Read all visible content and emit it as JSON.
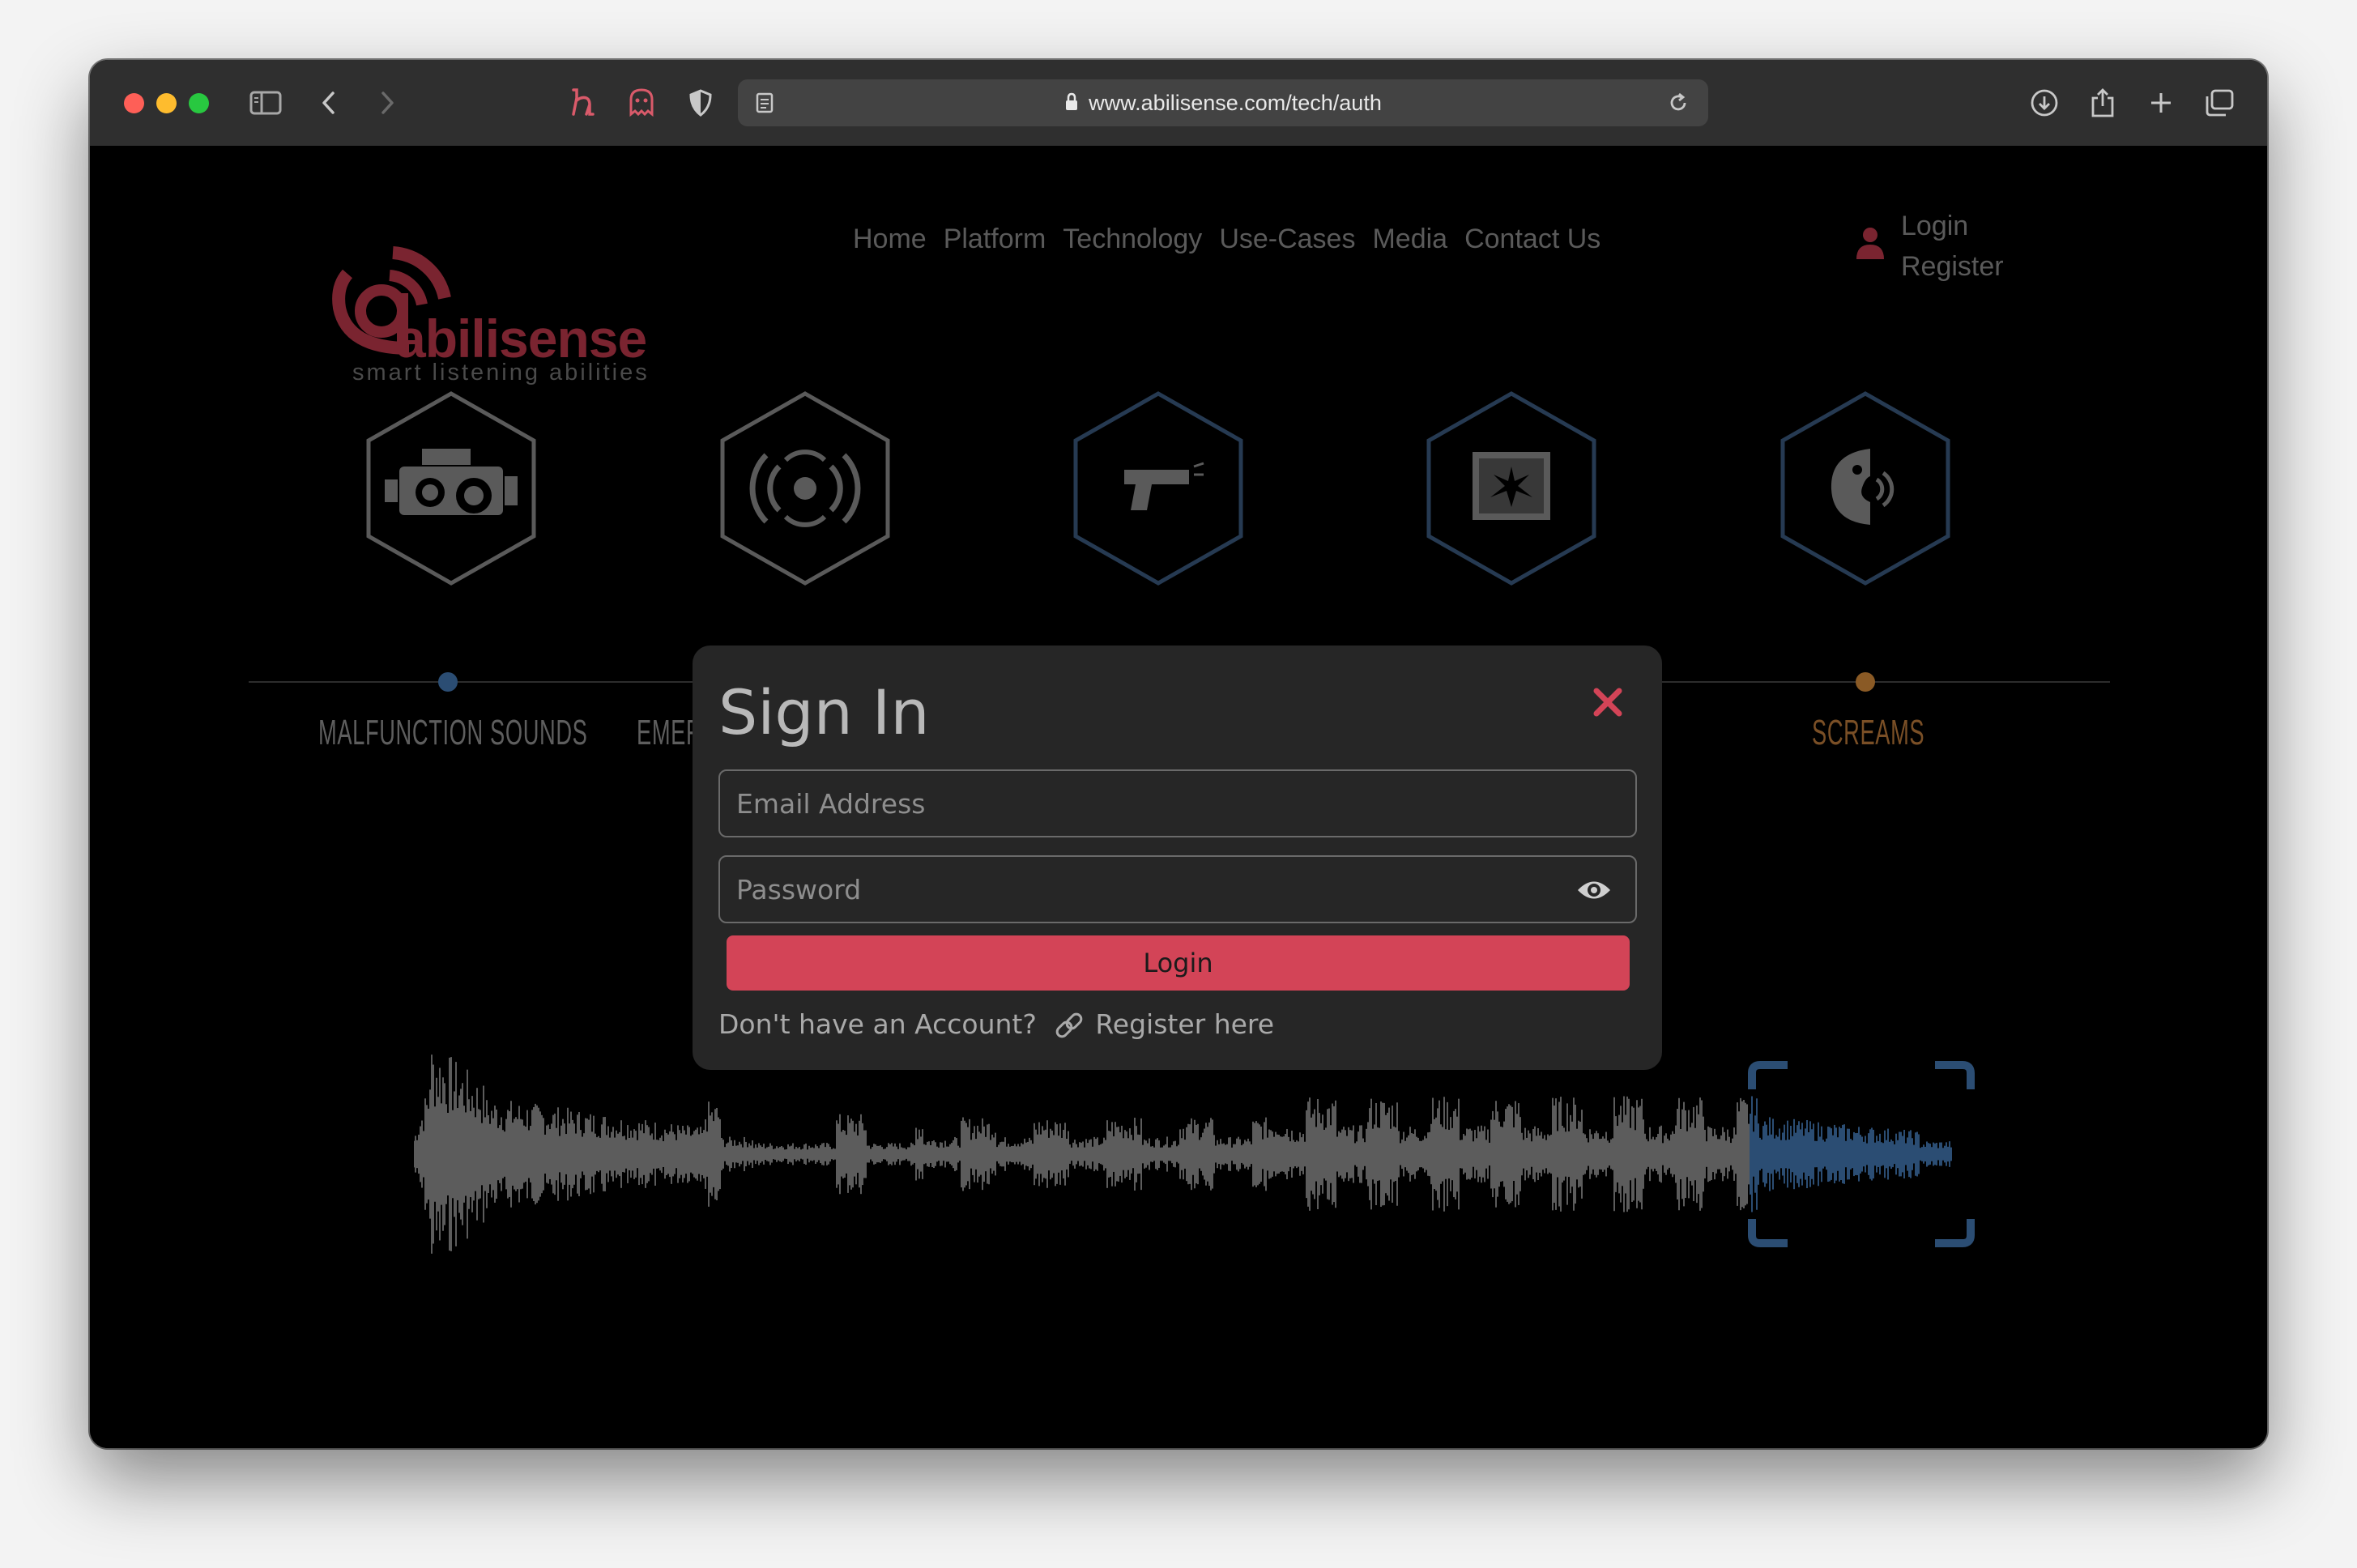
{
  "browser": {
    "url": "www.abilisense.com/tech/auth"
  },
  "site": {
    "logo_word": "abilisense",
    "logo_tagline": "smart listening abilities",
    "nav": [
      "Home",
      "Platform",
      "Technology",
      "Use-Cases",
      "Media",
      "Contact Us"
    ],
    "user_login": "Login",
    "user_register": "Register"
  },
  "categories": [
    {
      "label": "MALFUNCTION SOUNDS",
      "icon": "engine-icon",
      "color": "#5e5e5e"
    },
    {
      "label": "EMERGENCY",
      "icon": "alarm-icon",
      "color": "#5e5e5e"
    },
    {
      "label": "",
      "icon": "gun-icon",
      "color": "#5e5e5e"
    },
    {
      "label": "",
      "icon": "glass-break-icon",
      "color": "#5e5e5e"
    },
    {
      "label": "SCREAMS",
      "icon": "scream-icon",
      "color": "#7a4f26"
    }
  ],
  "modal": {
    "title": "Sign In",
    "email_placeholder": "Email Address",
    "password_placeholder": "Password",
    "login_label": "Login",
    "no_account_text": "Don't have an Account?",
    "register_link": "Register here"
  },
  "colors": {
    "accent": "#d34457",
    "logo": "#7a2430",
    "timeline_dot_blue": "#2b4d73",
    "timeline_dot_orange": "#8a5a25",
    "wave_highlight": "#2b4d73"
  }
}
